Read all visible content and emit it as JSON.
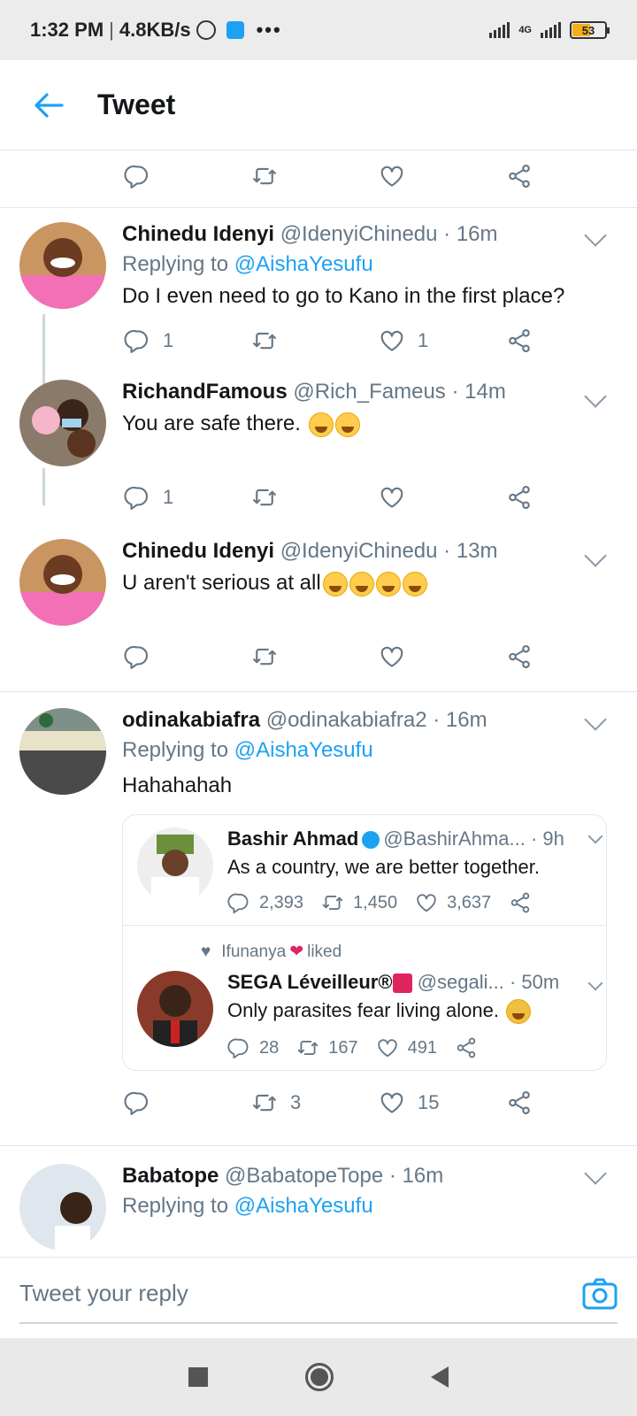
{
  "status_bar": {
    "time": "1:32 PM",
    "separator": "|",
    "speed": "4.8KB/s",
    "dots": "•••",
    "network": "4G",
    "battery": "53"
  },
  "header": {
    "title": "Tweet"
  },
  "top_actions": {
    "reply": "",
    "retweet": "",
    "like": ""
  },
  "thread": [
    {
      "name": "Chinedu Idenyi",
      "handle": "@IdenyiChinedu",
      "time": "· 16m",
      "replying_prefix": "Replying to",
      "replying_to": "@AishaYesufu",
      "text": "Do I even need to go to Kano in the first place?",
      "replies": "1",
      "retweets": "",
      "likes": "1"
    },
    {
      "name": "RichandFamous",
      "handle": "@Rich_Fameus",
      "time": "· 14m",
      "text": "You are safe there.",
      "replies": "1",
      "retweets": "",
      "likes": ""
    },
    {
      "name": "Chinedu Idenyi",
      "handle": "@IdenyiChinedu",
      "time": "· 13m",
      "text": "U aren't serious at all",
      "replies": "",
      "retweets": "",
      "likes": ""
    }
  ],
  "quote_tweet": {
    "name": "odinakabiafra",
    "handle": "@odinakabiafra2",
    "time": "· 16m",
    "replying_prefix": "Replying to",
    "replying_to": "@AishaYesufu",
    "text": "Hahahahah",
    "replies": "",
    "retweets": "3",
    "likes": "15",
    "embedded": [
      {
        "name": "Bashir Ahmad",
        "handle": "@BashirAhma...",
        "time": "· 9h",
        "text": "As a country, we are better together.",
        "replies": "2,393",
        "retweets": "1,450",
        "likes": "3,637"
      },
      {
        "liked_by": "Ifunanya",
        "liked_label": "liked",
        "name": "SEGA Léveilleur®",
        "handle": "@segali...",
        "time": "· 50m",
        "text": "Only parasites fear living alone.",
        "replies": "28",
        "retweets": "167",
        "likes": "491"
      }
    ]
  },
  "next_tweet": {
    "name": "Babatope",
    "handle": "@BabatopeTope",
    "time": "· 16m",
    "replying_prefix": "Replying to",
    "replying_to": "@AishaYesufu"
  },
  "reply_bar": {
    "placeholder": "Tweet your reply"
  },
  "colors": {
    "accent": "#1da1f2",
    "text": "#14171a",
    "muted": "#657786",
    "divider": "#e1e8ed"
  }
}
